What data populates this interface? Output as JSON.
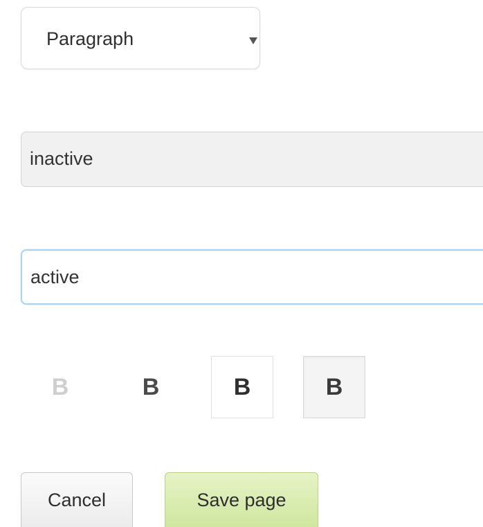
{
  "format_select": {
    "value": "Paragraph",
    "caret_icon": "triangle-down-icon"
  },
  "inputs": {
    "inactive": {
      "value": "inactive"
    },
    "active": {
      "value": "active"
    }
  },
  "bold_buttons": {
    "label": "B",
    "states": [
      "disabled",
      "normal",
      "hover",
      "pressed"
    ]
  },
  "actions": {
    "cancel_label": "Cancel",
    "save_label": "Save page"
  },
  "colors": {
    "active_border": "#a9d3f5",
    "save_bg": "#d8ebb0",
    "inactive_bg": "#f1f1f1"
  }
}
